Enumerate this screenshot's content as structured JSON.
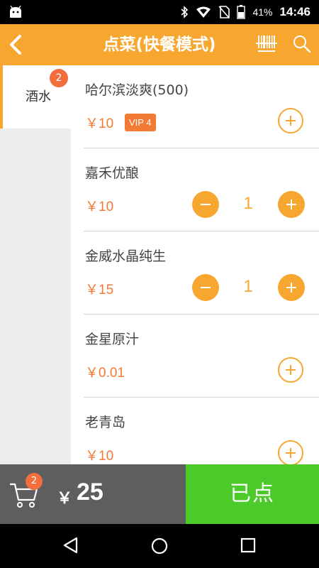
{
  "status_bar": {
    "battery": "41%",
    "time": "14:46",
    "icons": [
      "android-icon",
      "bluetooth-icon",
      "wifi-icon",
      "no-sim-icon",
      "battery-icon"
    ]
  },
  "header": {
    "title": "点菜(快餐模式)",
    "icons": [
      "back-icon",
      "barcode-scan-icon",
      "search-icon"
    ]
  },
  "sidebar": {
    "categories": [
      {
        "label": "酒水",
        "badge": "2",
        "selected": true
      }
    ]
  },
  "items": [
    {
      "name": "哈尔滨淡爽(500)",
      "price": "￥10",
      "vip": "VIP 4",
      "qty": null
    },
    {
      "name": "嘉禾优酿",
      "price": "￥10",
      "qty": "1"
    },
    {
      "name": "金威水晶纯生",
      "price": "￥15",
      "qty": "1"
    },
    {
      "name": "金星原汁",
      "price": "￥0.01",
      "qty": null
    },
    {
      "name": "老青岛",
      "price": "￥10",
      "qty": null
    }
  ],
  "cart": {
    "badge": "2",
    "currency": "￥",
    "total": "25",
    "ordered_label": "已点"
  },
  "colors": {
    "accent": "#f7a630",
    "price": "#f37a35",
    "badge": "#f26f3d",
    "ordered": "#4cca2a",
    "cartbar": "#5e5e5e"
  },
  "nav": {
    "icons": [
      "back-triangle-icon",
      "home-circle-icon",
      "recents-square-icon"
    ]
  }
}
